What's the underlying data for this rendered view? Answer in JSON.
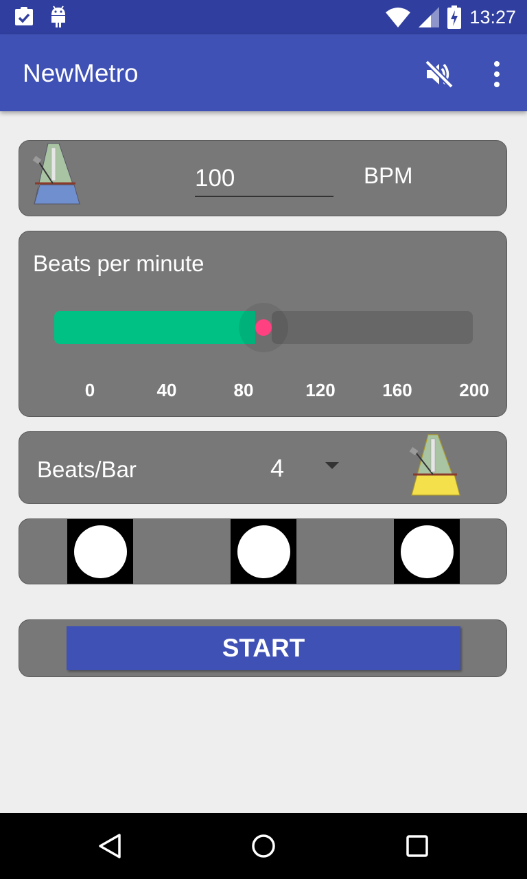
{
  "status_bar": {
    "time": "13:27",
    "icons": [
      "clipboard-check-icon",
      "android-icon",
      "wifi-icon",
      "signal-icon",
      "battery-charging-icon"
    ]
  },
  "app_bar": {
    "title": "NewMetro",
    "actions": [
      "volume-off-icon",
      "overflow-menu-icon"
    ]
  },
  "bpm_card": {
    "value": "100",
    "unit": "BPM"
  },
  "slider_card": {
    "label": "Beats per minute",
    "min": 0,
    "max": 200,
    "value": 100,
    "ticks": [
      "0",
      "40",
      "80",
      "120",
      "160",
      "200"
    ],
    "fill_color": "#00c184",
    "thumb_color": "#ff4081"
  },
  "beats_bar_card": {
    "label": "Beats/Bar",
    "selected": "4"
  },
  "beat_indicators": {
    "count": 3
  },
  "start_button": {
    "label": "START"
  },
  "nav_bar": {
    "buttons": [
      "back-icon",
      "home-icon",
      "recents-icon"
    ]
  },
  "colors": {
    "primary": "#3f51b5",
    "primary_dark": "#303f9f",
    "card": "#787878",
    "background": "#eeeeee"
  }
}
